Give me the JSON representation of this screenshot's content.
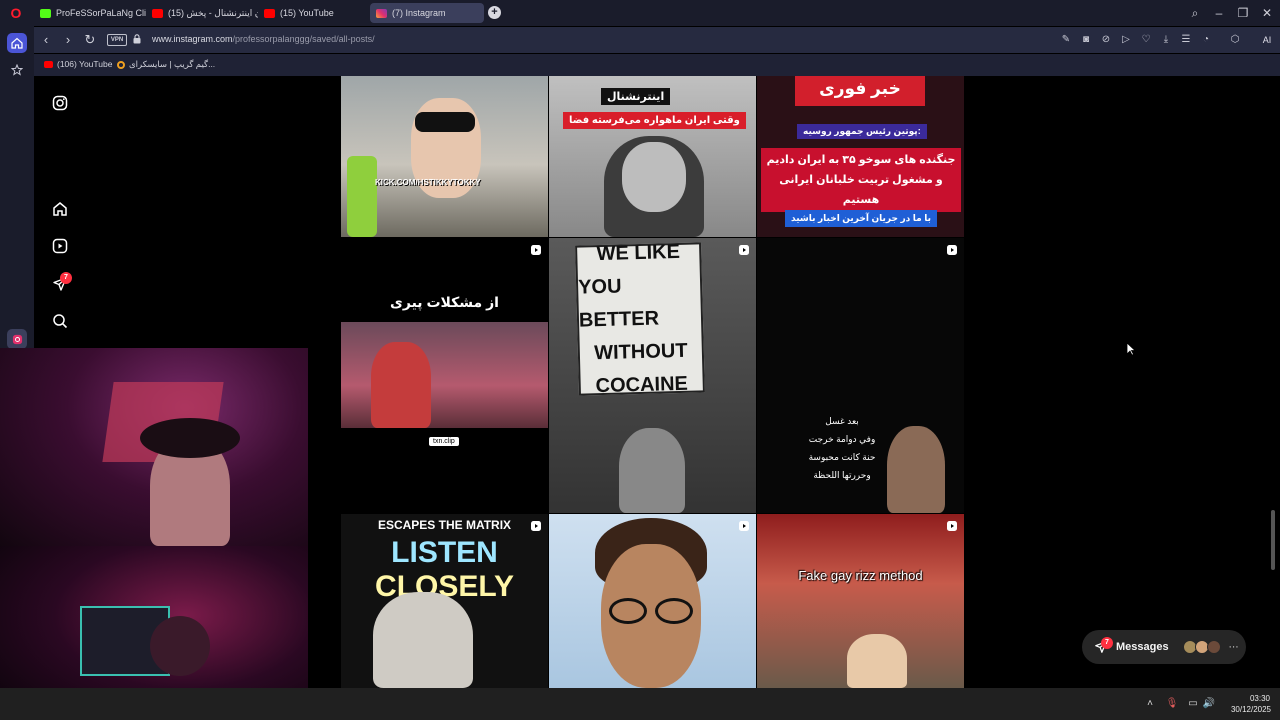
{
  "browser": {
    "tabs": [
      {
        "title": "ProFeSSorPaLaNg Clips - ",
        "favicon": "kick-icon"
      },
      {
        "title": "(15) ایران اینترنشنال - پخش",
        "favicon": "youtube-icon"
      },
      {
        "title": "(15) YouTube",
        "favicon": "youtube-icon"
      },
      {
        "title": "(7) Instagram",
        "favicon": "instagram-icon",
        "active": true
      }
    ],
    "vpn_label": "VPN",
    "url_host": "www.instagram.com",
    "url_path": "/professorpalanggg/saved/all-posts/",
    "ai_label": "AI",
    "bookmarks": [
      {
        "label": "(106) YouTube",
        "icon": "youtube-icon"
      },
      {
        "label": "گیم گریپ | سایسکرای...",
        "icon": "gamegrip-icon"
      }
    ]
  },
  "instagram": {
    "notifications_count": "7",
    "posts": [
      {
        "caption": "KICK.COM/HSTIKKYTOKKY"
      },
      {
        "caption_top": "اینترنشنال",
        "caption_bottom": "وقتی ایران ماهواره می‌فرسته فضا"
      },
      {
        "headline": "خبر فوری",
        "subhead": "پوتین رئیس جمهور روسیه:",
        "body": "جنگنده های سوخو ۳۵ به ایران دادیم و مشغول تربیت خلبانان ایرانی هستیم",
        "footer": "با ما در جریان آخرین اخبار باشید"
      },
      {
        "caption": "از مشکلات پیری",
        "tag": "txn.clip"
      },
      {
        "sign_lines": [
          "WE LIKE",
          "YOU BETTER",
          "WITHOUT",
          "COCAINE"
        ]
      },
      {
        "lines": [
          "بعد غسل",
          "وفي دوامة خرجت",
          "حنة كانت محبوسة",
          "وحررتها اللحظة"
        ]
      },
      {
        "caption_top": "ESCAPES THE MATRIX",
        "caption_main_a": "LISTEN",
        "caption_main_b": "CLOSELY"
      },
      {
        "caption": ""
      },
      {
        "caption": "Fake gay rizz method"
      }
    ],
    "messages_label": "Messages",
    "messages_count": "7"
  },
  "taskbar": {
    "time": "03:30",
    "date": "30/12/2025"
  },
  "colors": {
    "chrome_bg": "#1a1c2b",
    "address_bg": "#262a40",
    "ig_badge": "#ff3040",
    "opera_red": "#ff1b2d"
  }
}
